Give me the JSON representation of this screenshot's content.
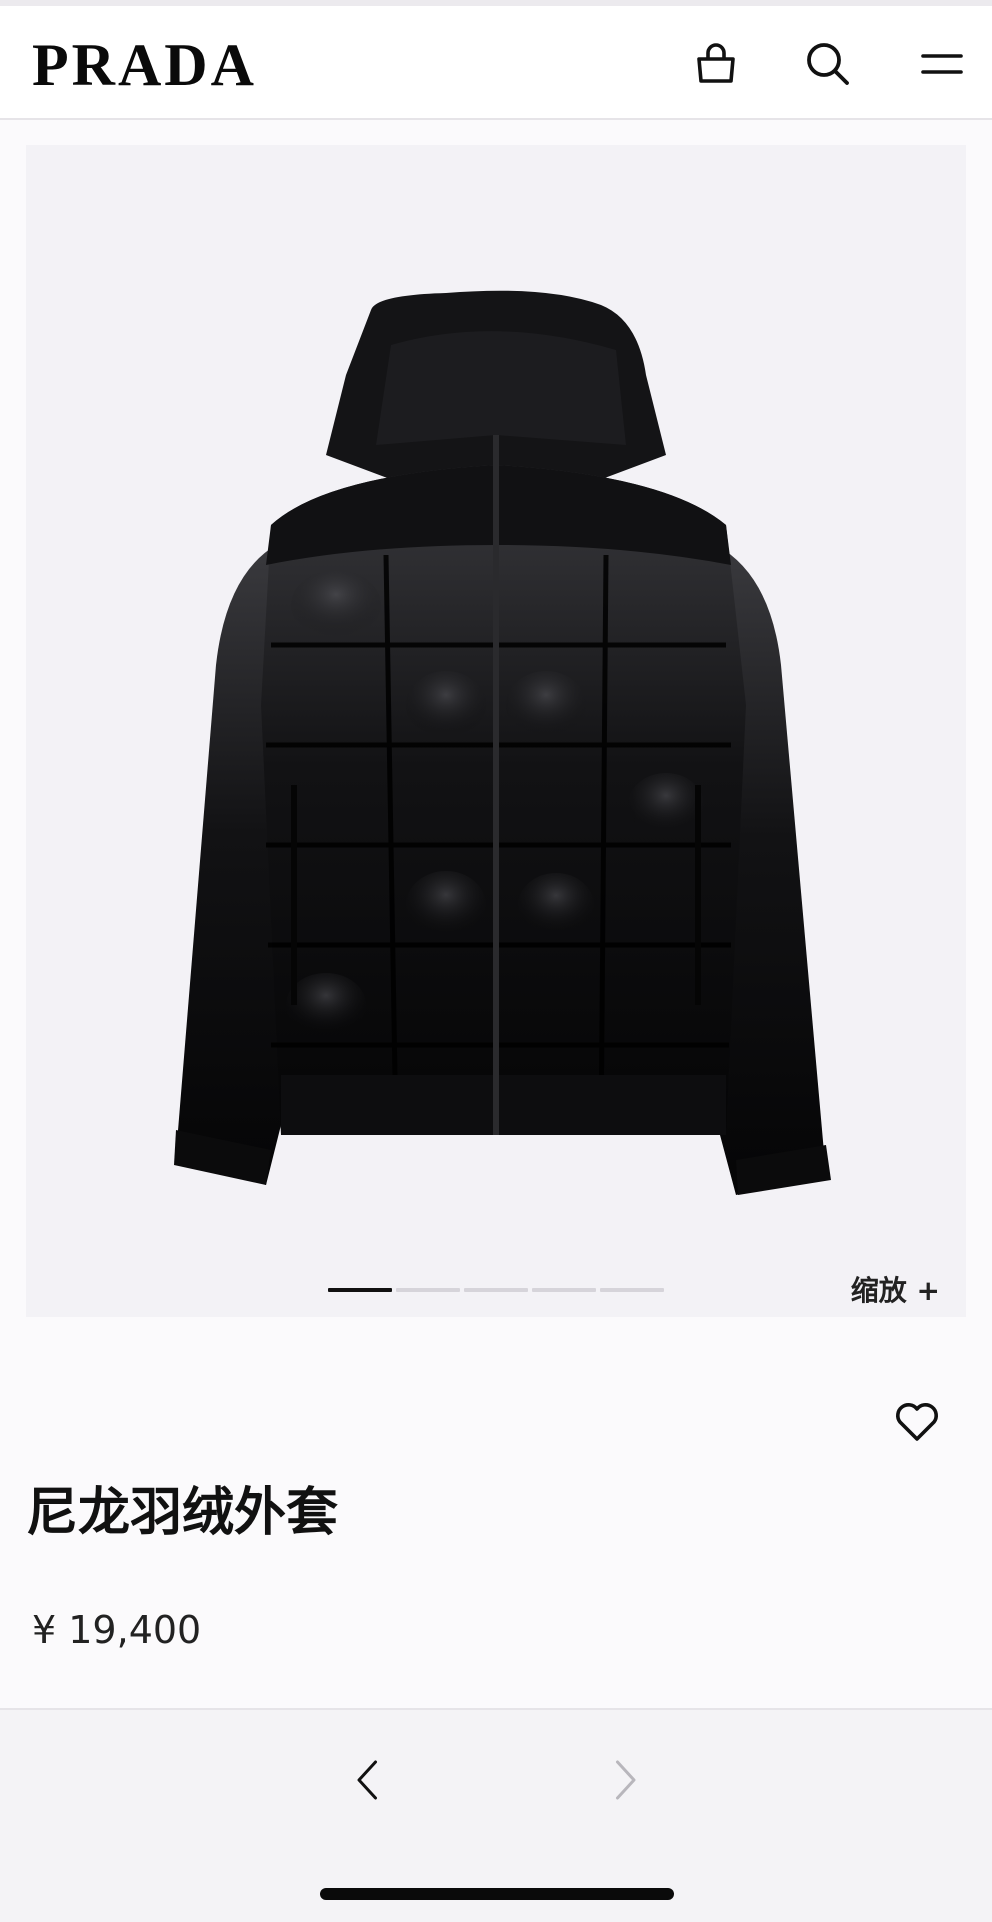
{
  "header": {
    "logo": "PRADA",
    "icons": [
      "shopping-bag-icon",
      "search-icon",
      "menu-icon"
    ]
  },
  "gallery": {
    "image_alt": "black quilted nylon down jacket with hood",
    "slide_count": 5,
    "active_slide": 1,
    "zoom_label": "缩放 +"
  },
  "product": {
    "title": "尼龙羽绒外套",
    "price": "¥  19,400",
    "favorite_icon": "heart-icon"
  },
  "footer": {
    "prev_icon": "chevron-left-icon",
    "next_icon": "chevron-right-icon",
    "next_enabled": false
  },
  "colors": {
    "background": "#fbfafc",
    "image_background": "#f3f2f6",
    "text": "#111111",
    "disabled": "#b8b6bc"
  }
}
